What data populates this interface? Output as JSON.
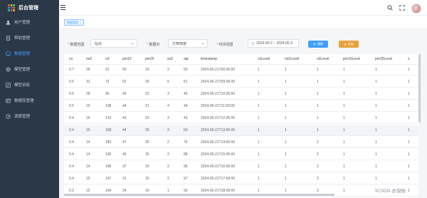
{
  "brand": {
    "title": "后台管理",
    "logo_colors": [
      "#e74c3c",
      "#f1c40f",
      "#2ecc71",
      "#3498db",
      "#9b59b6",
      "#e67e22",
      "#1abc9c",
      "#e84393",
      "#f39c12"
    ]
  },
  "sidebar": {
    "items": [
      {
        "label": "用户管理",
        "icon": "user-icon",
        "active": false
      },
      {
        "label": "帮助管理",
        "icon": "document-icon",
        "active": false
      },
      {
        "label": "数据管理",
        "icon": "data-icon",
        "active": true
      },
      {
        "label": "模型管理",
        "icon": "gear-icon",
        "active": false
      },
      {
        "label": "模型训练",
        "icon": "edit-icon",
        "active": false
      },
      {
        "label": "数据库管理",
        "icon": "database-icon",
        "active": false
      },
      {
        "label": "调度管理",
        "icon": "clock-icon",
        "active": false
      }
    ]
  },
  "header": {
    "icons": [
      "search-icon",
      "fullscreen-icon",
      "avatar"
    ]
  },
  "tagbar": {
    "tag_label": "数据管理",
    "close": "×"
  },
  "filters": {
    "range_label": "数据范围",
    "range_value": "站点",
    "data_label": "数据ID",
    "data_value": "万寿西宫",
    "time_label": "时间范围",
    "time_start": "2024-05-2",
    "time_sep": "-",
    "time_end": "2024-05-2",
    "search_button": "搜索",
    "export_button": "导出"
  },
  "table": {
    "columns": [
      "co",
      "no2",
      "o3",
      "pm10",
      "pm25",
      "so2",
      "aqi",
      "timestamp",
      "coLevel",
      "no2Level",
      "o3Level",
      "pm10Level",
      "pm25Level",
      "s"
    ],
    "rows": [
      [
        "0.7",
        "28",
        "91",
        "50",
        "19",
        "2",
        "50",
        "2024-05-21T00:00:00",
        "1",
        "1",
        "1",
        "1",
        "1",
        "1"
      ],
      [
        "0.6",
        "31",
        "73",
        "52",
        "26",
        "5",
        "51",
        "2024-05-21T09:00:00",
        "1",
        "1",
        "1",
        "1",
        "1",
        "1"
      ],
      [
        "0.5",
        "28",
        "90",
        "45",
        "22",
        "3",
        "45",
        "2024-05-21T10:00:00",
        "1",
        "1",
        "1",
        "1",
        "1",
        "1"
      ],
      [
        "0.5",
        "19",
        "108",
        "44",
        "21",
        "4",
        "44",
        "2024-05-21T11:00:00",
        "1",
        "1",
        "1",
        "1",
        "1",
        "1"
      ],
      [
        "0.4",
        "16",
        "133",
        "43",
        "23",
        "3",
        "43",
        "2024-05-21T12:00:00",
        "1",
        "1",
        "1",
        "1",
        "1",
        "1"
      ],
      [
        "0.4",
        "15",
        "158",
        "44",
        "25",
        "3",
        "50",
        "2024-05-21T13:00:00",
        "1",
        "1",
        "1",
        "1",
        "1",
        "1"
      ],
      [
        "0.4",
        "14",
        "180",
        "47",
        "26",
        "2",
        "75",
        "2024-05-21T14:00:00",
        "1",
        "1",
        "2",
        "1",
        "1",
        "1"
      ],
      [
        "0.4",
        "14",
        "190",
        "45",
        "25",
        "2",
        "88",
        "2024-05-21T15:00:00",
        "1",
        "1",
        "2",
        "1",
        "1",
        "1"
      ],
      [
        "0.4",
        "14",
        "198",
        "37",
        "20",
        "2",
        "96",
        "2024-05-21T16:00:00",
        "1",
        "1",
        "2",
        "1",
        "1",
        "1"
      ],
      [
        "0.4",
        "15",
        "197",
        "31",
        "15",
        "2",
        "97",
        "2024-05-21T17:00:00",
        "1",
        "1",
        "2",
        "1",
        "1",
        "1"
      ],
      [
        "0.3",
        "15",
        "194",
        "34",
        "16",
        "1",
        "93",
        "2024-05-21T18:00:00",
        "1",
        "1",
        "2",
        "1",
        "1",
        "1"
      ]
    ],
    "highlight_row": 5
  },
  "watermark": "CSDN @倪杨"
}
